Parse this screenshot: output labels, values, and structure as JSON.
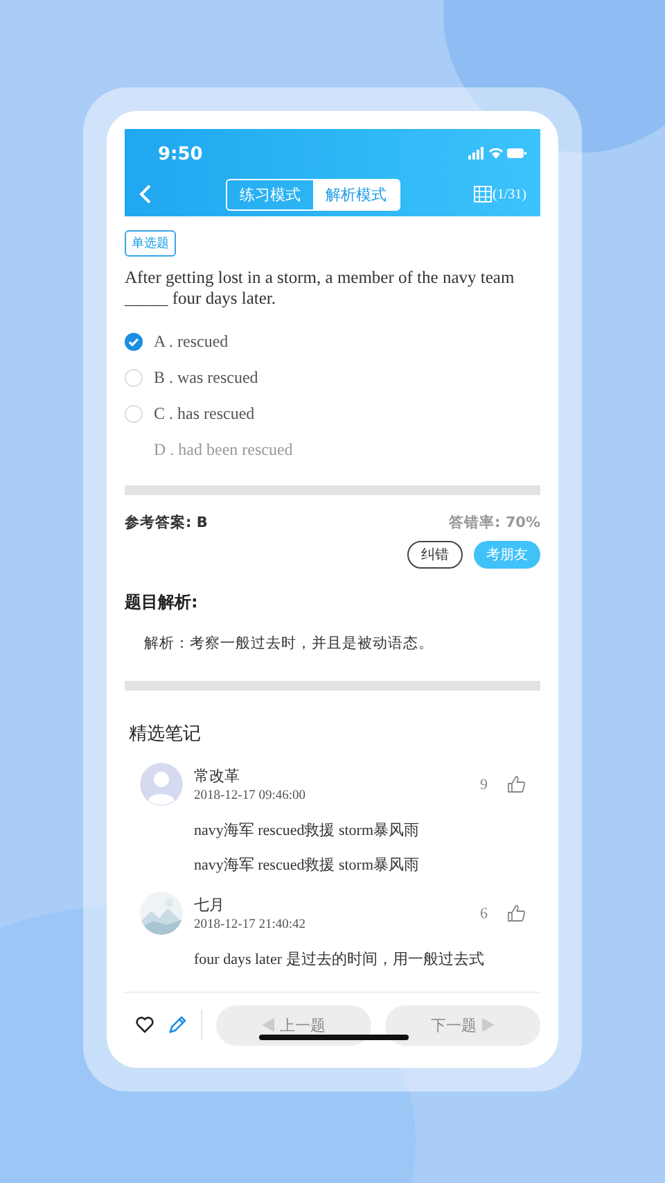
{
  "status_bar": {
    "time": "9:50"
  },
  "nav": {
    "tabs": [
      {
        "label": "练习模式",
        "selected": false
      },
      {
        "label": "解析模式",
        "selected": true
      }
    ],
    "counter": "(1/31)"
  },
  "question": {
    "type_tag": "单选题",
    "text": "After getting lost in a storm, a member of the navy team _____ four days later.",
    "options": [
      {
        "kind": "radio",
        "label": "A . rescued",
        "selected": true
      },
      {
        "kind": "radio",
        "label": "B . was rescued",
        "selected": false
      },
      {
        "kind": "radio",
        "label": "C . has rescued",
        "selected": false
      },
      {
        "kind": "plain",
        "label": "D . had been rescued",
        "selected": false
      }
    ]
  },
  "answer": {
    "reference": "参考答案: B",
    "error_rate": "答错率: 70%",
    "buttons": [
      {
        "kind": "outline",
        "label": "纠错"
      },
      {
        "kind": "filled",
        "label": "考朋友"
      }
    ]
  },
  "analysis": {
    "heading": "题目解析:",
    "text": "解析：考察一般过去时，并且是被动语态。"
  },
  "notes": {
    "heading": "精选笔记",
    "items": [
      {
        "kind": "silhouette",
        "author": "常改革",
        "time": "2018-12-17 09:46:00",
        "likes": "9",
        "lines": [
          "navy海军 rescued救援 storm暴风雨",
          "navy海军 rescued救援 storm暴风雨"
        ]
      },
      {
        "kind": "picture",
        "author": "七月",
        "time": "2018-12-17 21:40:42",
        "likes": "6",
        "lines": [
          "four days later 是过去的时间，用一般过去式"
        ]
      }
    ]
  },
  "bottom_bar": {
    "prev": "上一题",
    "next": "下一题"
  }
}
